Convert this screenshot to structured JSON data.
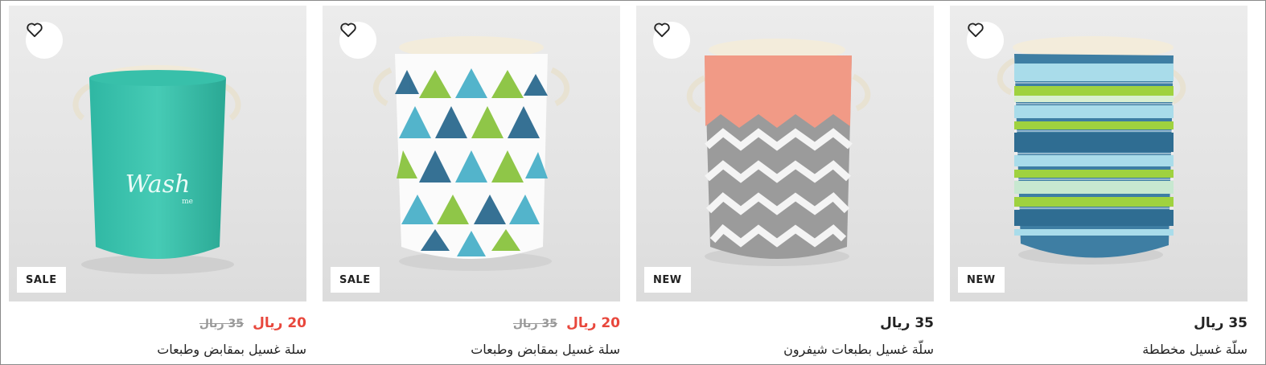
{
  "products": [
    {
      "name": "سلة غسيل بمقابض وطبعات",
      "price": "20 ريال",
      "old_price": "35 ريال",
      "badge": "SALE",
      "on_sale": true,
      "image": "teal laundry basket with \"Wash me\" print",
      "image_text": "Wash",
      "image_subtext": "me"
    },
    {
      "name": "سلة غسيل بمقابض وطبعات",
      "price": "20 ريال",
      "old_price": "35 ريال",
      "badge": "SALE",
      "on_sale": true,
      "image": "white laundry basket with blue and green triangle print"
    },
    {
      "name": "سلّة غسيل بطبعات شيفرون",
      "price": "35 ريال",
      "old_price": "",
      "badge": "NEW",
      "on_sale": false,
      "image": "laundry basket with coral top and grey chevron print"
    },
    {
      "name": "سلّة غسيل مخططة",
      "price": "35 ريال",
      "old_price": "",
      "badge": "NEW",
      "on_sale": false,
      "image": "laundry basket with blue, teal and green stripes"
    }
  ],
  "colors": {
    "sale_price": "#e8473c",
    "old_price": "#999999",
    "text": "#222222",
    "badge_bg": "#ffffff",
    "image_bg": "#e6e6e6"
  },
  "icons": {
    "favorite": "heart-outline-icon"
  }
}
